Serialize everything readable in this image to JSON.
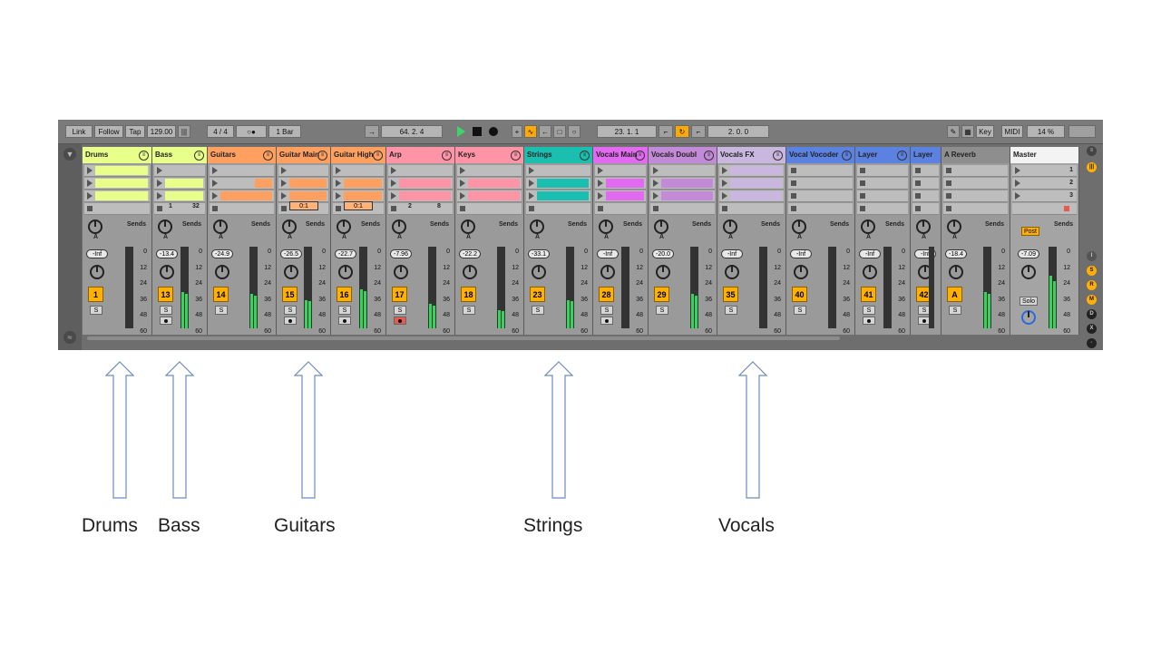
{
  "transport": {
    "link": "Link",
    "follow": "Follow",
    "tap": "Tap",
    "tempo": "129.00",
    "time_signature": "4 / 4",
    "metronome": "○●",
    "quantize": "1 Bar",
    "arrangement_position": "64.  2.  4",
    "loop_start": "23.  1.  1",
    "loop_length": "2.  0.  0",
    "key": "Key",
    "midi": "MIDI",
    "cpu": "14 %"
  },
  "tracks": [
    {
      "name": "Drums",
      "color": "#e8ff8a",
      "volume": "-Inf",
      "number": "1"
    },
    {
      "name": "Bass",
      "color": "#e8ff8a",
      "volume": "-13.4",
      "number": "13"
    },
    {
      "name": "Guitars",
      "color": "#ffa060",
      "volume": "-24.9",
      "number": "14"
    },
    {
      "name": "Guitar Main",
      "color": "#ffa060",
      "volume": "-26.5",
      "number": "15",
      "ratio": "0:1"
    },
    {
      "name": "Guitar High",
      "color": "#ffa060",
      "volume": "-22.7",
      "number": "16",
      "ratio": "0:1"
    },
    {
      "name": "Arp",
      "color": "#ff94a6",
      "volume": "-7.96",
      "number": "17"
    },
    {
      "name": "Keys",
      "color": "#ff94a6",
      "volume": "-22.2",
      "number": "18"
    },
    {
      "name": "Strings",
      "color": "#1bbfb0",
      "volume": "-33.1",
      "number": "23"
    },
    {
      "name": "Vocals Main",
      "color": "#e16af0",
      "volume": "-Inf",
      "number": "28"
    },
    {
      "name": "Vocals Doubl",
      "color": "#c38ad8",
      "volume": "-20.0",
      "number": "29"
    },
    {
      "name": "Vocals FX",
      "color": "#c9b7e0",
      "volume": "-Inf",
      "number": "35"
    },
    {
      "name": "Vocal Vocoder",
      "color": "#5b82e0",
      "volume": "-Inf",
      "number": "40"
    },
    {
      "name": "Layer",
      "color": "#5b82e0",
      "volume": "-Inf",
      "number": "41"
    },
    {
      "name": "Layer",
      "color": "#5b82e0",
      "volume": "-Inf",
      "number": "42"
    },
    {
      "name": "A Reverb",
      "color": "#9a9a9a",
      "volume": "-18.4",
      "number": "A"
    }
  ],
  "master": {
    "name": "Master",
    "volume": "-7.09",
    "post": "Post",
    "solo": "Solo",
    "scenes": [
      "1",
      "2",
      "3"
    ]
  },
  "bass_clip_info": {
    "left": "1",
    "right": "32"
  },
  "arp_clip_info": {
    "left": "2",
    "right": "8"
  },
  "sends_label": "Sends",
  "send_knob_label": "A",
  "solo_label": "S",
  "meter_scale": [
    "0",
    "12",
    "24",
    "36",
    "48",
    "60"
  ],
  "annotations": [
    "Drums",
    "Bass",
    "Guitars",
    "Strings",
    "Vocals"
  ]
}
